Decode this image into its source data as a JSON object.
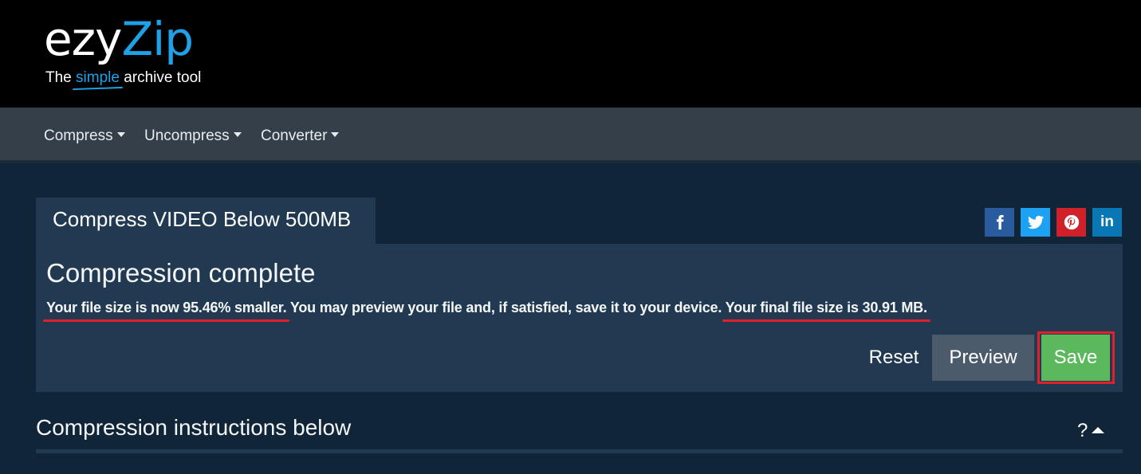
{
  "brand": {
    "logo_part1": "ezy",
    "logo_part2": "Zip",
    "tagline_before": "The ",
    "tagline_highlight": "simple",
    "tagline_after": " archive tool",
    "accent_color": "#1ea1e6"
  },
  "nav": {
    "items": [
      {
        "label": "Compress"
      },
      {
        "label": "Uncompress"
      },
      {
        "label": "Converter"
      }
    ]
  },
  "tab": {
    "label": "Compress VIDEO Below 500MB"
  },
  "social": {
    "facebook": "f",
    "twitter": "t",
    "pinterest": "p",
    "linkedin": "in"
  },
  "result": {
    "title": "Compression complete",
    "msg_part1": "Your file size is now 95.46% smaller.",
    "msg_part2": " You may preview your file and, if satisfied, save it to your device. ",
    "msg_part3": "Your final file size is 30.91 MB."
  },
  "actions": {
    "reset_label": "Reset",
    "preview_label": "Preview",
    "save_label": "Save"
  },
  "instructions": {
    "title": "Compression instructions below",
    "toggle_label": "?"
  }
}
